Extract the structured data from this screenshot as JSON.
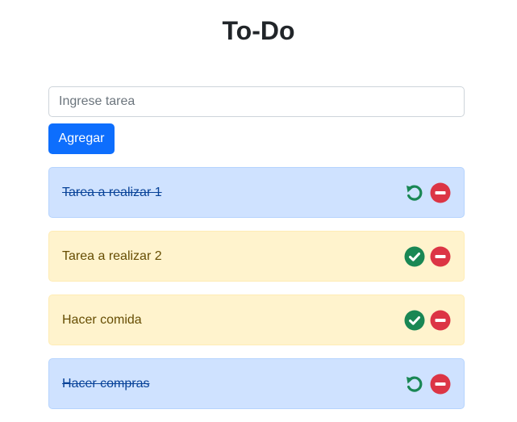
{
  "title": "To-Do",
  "input": {
    "placeholder": "Ingrese tarea",
    "value": ""
  },
  "add_button_label": "Agregar",
  "tasks": [
    {
      "text": "Tarea a realizar 1",
      "done": true
    },
    {
      "text": "Tarea a realizar 2",
      "done": false
    },
    {
      "text": "Hacer comida",
      "done": false
    },
    {
      "text": "Hacer compras",
      "done": true
    }
  ],
  "icons": {
    "undo": "undo-icon",
    "complete": "check-circle-icon",
    "delete": "minus-circle-icon"
  },
  "colors": {
    "primary": "#0d6efd",
    "success": "#198754",
    "danger": "#dc3545",
    "done_bg": "#cfe2ff",
    "pending_bg": "#fff3cd"
  }
}
